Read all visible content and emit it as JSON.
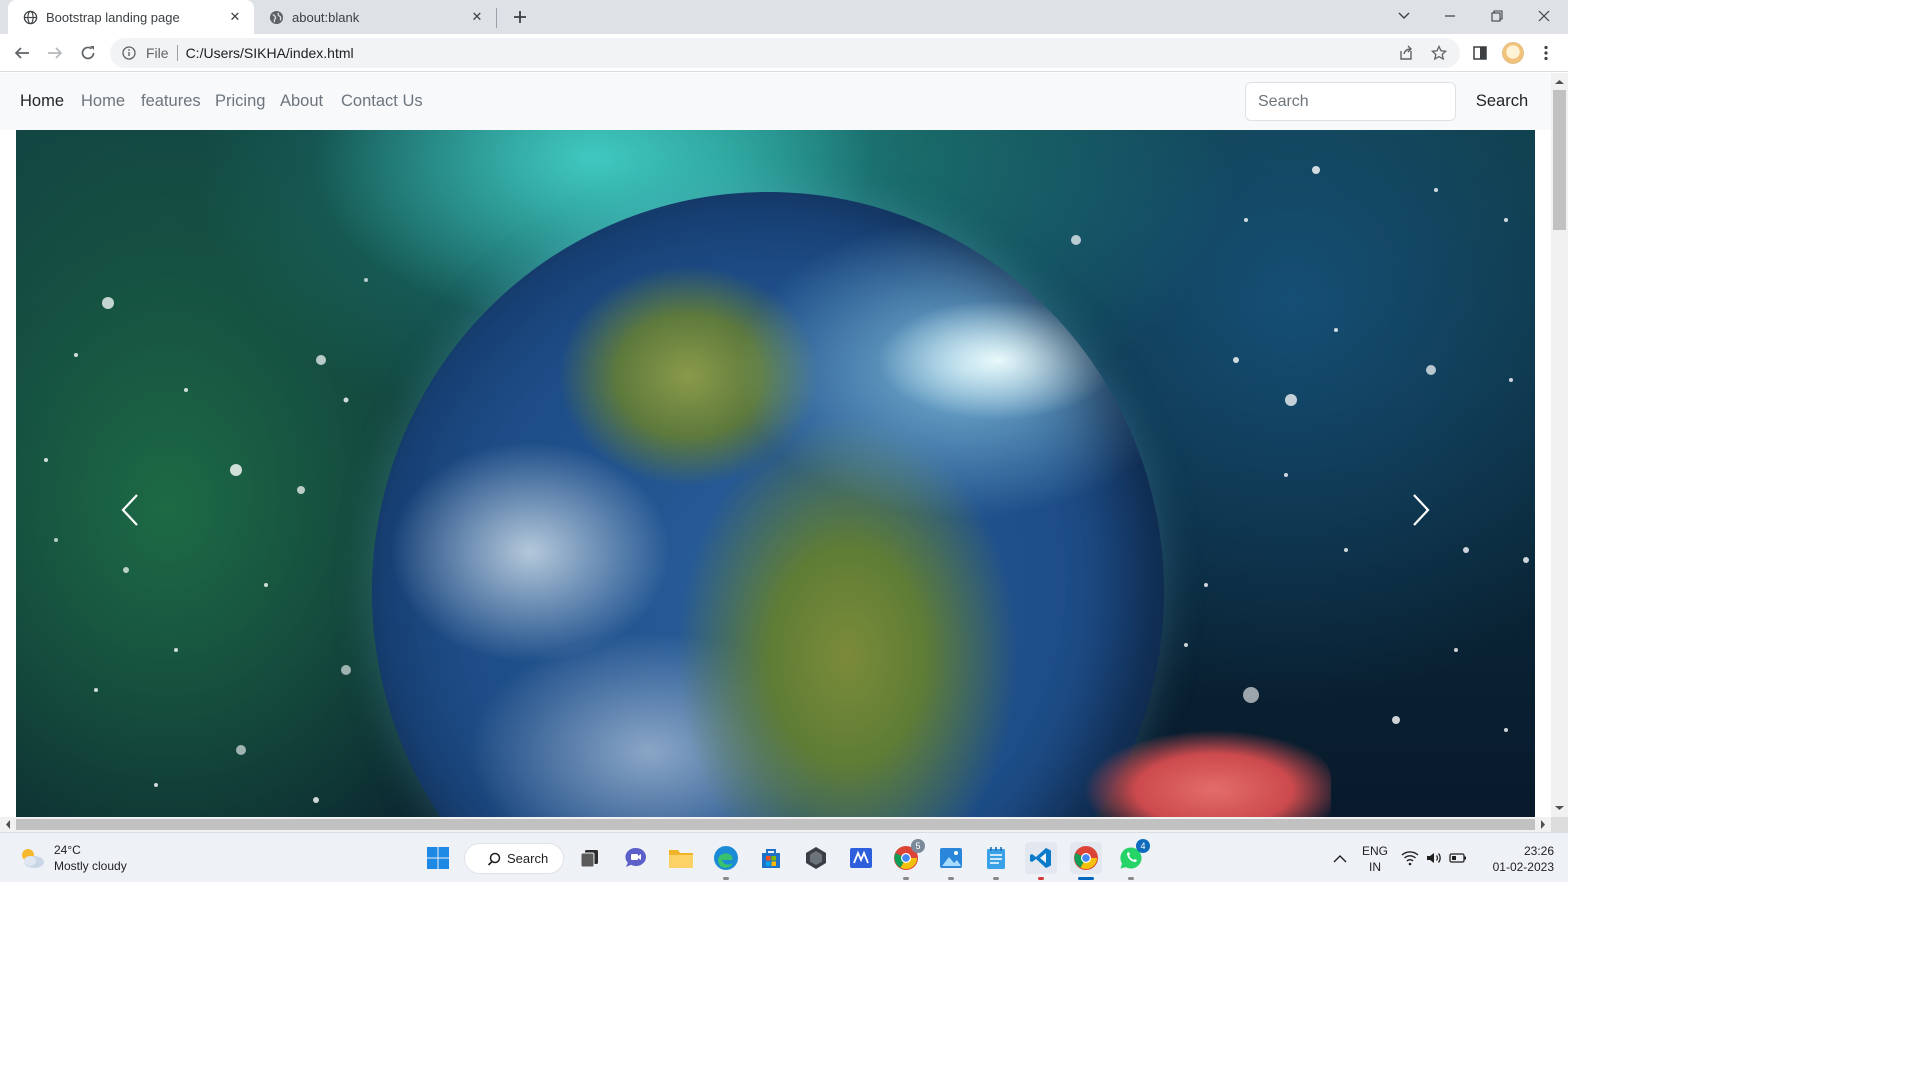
{
  "browser": {
    "tabs": [
      {
        "title": "Bootstrap landing page",
        "active": true,
        "icon": "globe-icon"
      },
      {
        "title": "about:blank",
        "active": false,
        "icon": "globe-icon"
      }
    ],
    "address": {
      "scheme_label": "File",
      "url": "C:/Users/SIKHA/index.html"
    }
  },
  "navbar": {
    "brand": "Home",
    "links": [
      "Home",
      "features",
      "Pricing",
      "About",
      "Contact Us"
    ],
    "search": {
      "placeholder": "Search",
      "button_label": "Search"
    }
  },
  "carousel": {
    "image_subject": "earth in space held by hand",
    "prev_icon": "chevron-left-icon",
    "next_icon": "chevron-right-icon"
  },
  "taskbar": {
    "weather": {
      "temperature": "24°C",
      "condition": "Mostly cloudy"
    },
    "search_label": "Search",
    "chrome_badge": "5",
    "whatsapp_badge": "4",
    "language": "ENG",
    "region": "IN",
    "time": "23:26",
    "date": "01-02-2023"
  },
  "colors": {
    "accent": "#0067c0",
    "navbar_bg": "#f8f9fa",
    "link": "#6c757d",
    "brand": "#212529"
  }
}
